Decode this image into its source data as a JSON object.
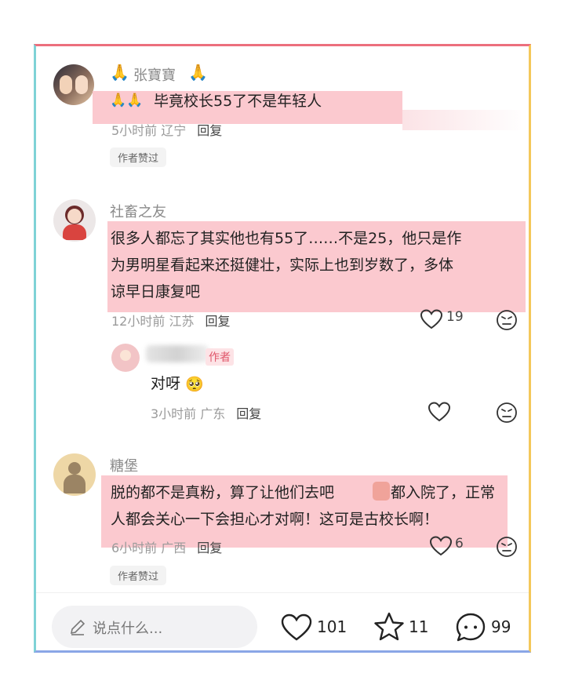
{
  "comments": [
    {
      "name": "张寶寶",
      "text": "毕竟校长55了不是年轻人",
      "time_location": "5小时前 辽宁",
      "reply_label": "回复",
      "badge": "作者赞过"
    },
    {
      "name": "社畜之友",
      "lines": [
        "很多人都忘了其实他也有55了……不是25，他只是作",
        "为男明星看起来还挺健壮，实际上也到岁数了，多体",
        "谅早日康复吧"
      ],
      "time_location": "12小时前 江苏",
      "reply_label": "回复",
      "likes": "19"
    },
    {
      "author_tag": "作者",
      "text": "对呀",
      "time_location": "3小时前 广东",
      "reply_label": "回复"
    },
    {
      "name": "糖堡",
      "lines": [
        "脱的都不是真粉，算了让他们去吧",
        "都入院了，正常",
        "人都会关心一下会担心才对啊！这可是古校长啊！"
      ],
      "time_location": "6小时前 广西",
      "reply_label": "回复",
      "likes": "6",
      "badge": "作者赞过"
    }
  ],
  "bottom_bar": {
    "input_placeholder": "说点什么...",
    "likes": "101",
    "stars": "11",
    "comments": "99"
  },
  "colors": {
    "highlight": "#fbc9cf",
    "frame_top": "#ec6f7d",
    "frame_left": "#7fd2d6",
    "frame_right": "#f4c85a",
    "frame_bottom": "#8aa6e6"
  },
  "icons": [
    "pray-emoji",
    "heart-icon",
    "angry-face-icon",
    "star-icon",
    "comment-bubble-icon",
    "pencil-icon",
    "pleading-face-emoji",
    "sticker-emoji"
  ]
}
